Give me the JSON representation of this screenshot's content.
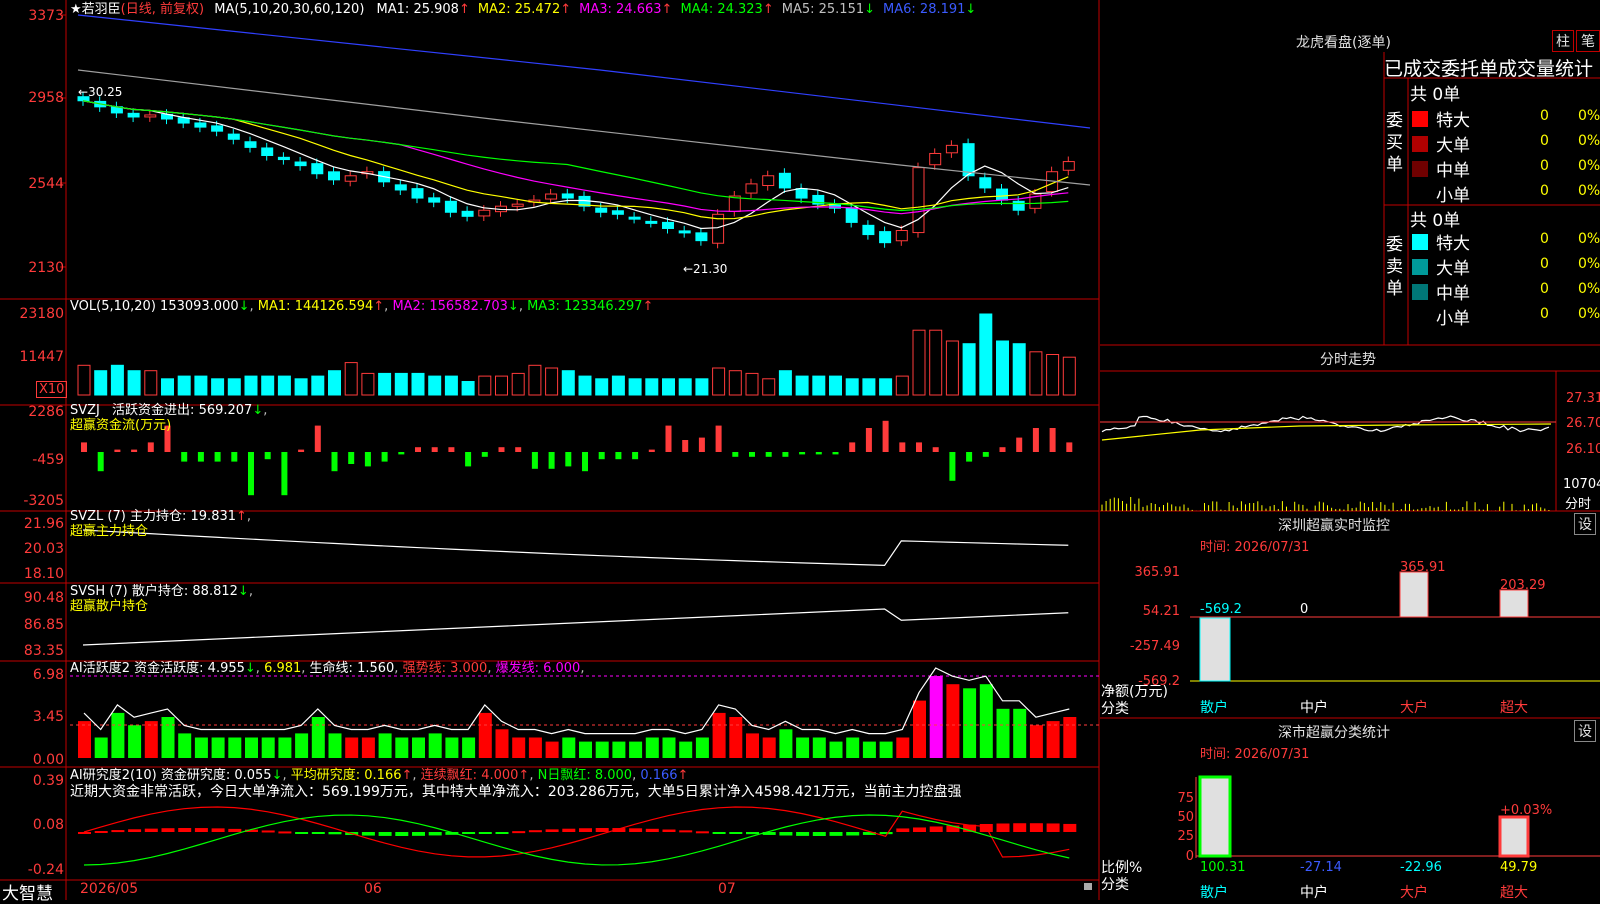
{
  "stock": {
    "star": "★",
    "name": "若羽臣",
    "period": "(日线, 前复权)"
  },
  "main_chart": {
    "ma_label": "MA(5,10,20,30,60,120)",
    "ma": [
      {
        "key": "MA1",
        "value": "25.908",
        "arrow": "↑",
        "color": "#ffffff"
      },
      {
        "key": "MA2",
        "value": "25.472",
        "arrow": "↑",
        "color": "#ffff00"
      },
      {
        "key": "MA3",
        "value": "24.663",
        "arrow": "↑",
        "color": "#ff00ff"
      },
      {
        "key": "MA4",
        "value": "24.323",
        "arrow": "↑",
        "color": "#00ff00"
      },
      {
        "key": "MA5",
        "value": "25.151",
        "arrow": "↓",
        "color": "#c0c0c0"
      },
      {
        "key": "MA6",
        "value": "28.191",
        "arrow": "↓",
        "color": "#3b5bff"
      }
    ],
    "y_ticks": [
      "3373",
      "2958",
      "2544",
      "2130"
    ],
    "annotations": {
      "high": "←30.25",
      "low": "←21.30"
    }
  },
  "vol": {
    "label": "VOL(5,10,20)",
    "value": "153093.000",
    "arrow": "↓",
    "ma1": "MA1: 144126.594",
    "ma1_arrow": "↑",
    "ma2": "MA2: 156582.703",
    "ma2_arrow": "↓",
    "ma3": "MA3: 123346.297",
    "ma3_arrow": "↑",
    "y_ticks": [
      "23180",
      "11447"
    ],
    "unit": "X10"
  },
  "svzj": {
    "label": "SVZJ",
    "title": "活跃资金进出:",
    "value": "569.207",
    "arrow": "↓",
    "sub": "超赢资金流(万元)",
    "y_ticks": [
      "2286",
      "-459",
      "-3205"
    ]
  },
  "svzl": {
    "label": "SVZL (7)",
    "title": "主力持仓:",
    "value": "19.831",
    "arrow": "↑",
    "sub": "超赢主力持仓",
    "y_ticks": [
      "21.96",
      "20.03",
      "18.10"
    ]
  },
  "svsh": {
    "label": "SVSH (7)",
    "title": "散户持仓:",
    "value": "88.812",
    "arrow": "↓",
    "sub": "超赢散户持仓",
    "y_ticks": [
      "90.48",
      "86.85",
      "83.35"
    ]
  },
  "ai1": {
    "label": "AI活跃度2",
    "t1": "资金活跃度:",
    "v1": "4.955",
    "a1": "↓",
    "v2": "6.981",
    "t3": "生命线:",
    "v3": "1.560",
    "t4": "强势线:",
    "v4": "3.000",
    "t5": "爆发线:",
    "v5": "6.000",
    "y_ticks": [
      "6.98",
      "3.45",
      "0.00"
    ]
  },
  "ai2": {
    "label": "AI研究度2(10)",
    "t1": "资金研究度:",
    "v1": "0.055",
    "a1": "↓",
    "t2": "平均研究度:",
    "v2": "0.166",
    "a2": "↑",
    "t3": "连续飘红:",
    "v3": "4.000",
    "a3": "↑",
    "t4": "N日飘红:",
    "v4": "8.000",
    "v5": "0.166",
    "a5": "↑",
    "message": "近期大资金非常活跃，今日大单净流入：569.199万元，其中特大单净流入：203.286万元，大单5日累计净入4598.421万元，当前主力控盘强",
    "y_ticks": [
      "0.39",
      "0.08",
      "-0.24"
    ]
  },
  "x_axis": {
    "months": [
      "2026/05",
      "06",
      "07"
    ],
    "brand": "大智慧"
  },
  "longhu": {
    "title": "龙虎看盘(逐单)",
    "btn_zhu": "柱",
    "btn_bi": "笔",
    "subtitle": "已成交委托单成交量统计",
    "buy_label": "委买单",
    "sell_label": "委卖单",
    "buy_total": "共 0单",
    "sell_total": "共 0单",
    "buy_rows": [
      {
        "name": "特大",
        "count": "0",
        "pct": "0%",
        "color": "#ff0000"
      },
      {
        "name": "大单",
        "count": "0",
        "pct": "0%",
        "color": "#b00000"
      },
      {
        "name": "中单",
        "count": "0",
        "pct": "0%",
        "color": "#700000"
      },
      {
        "name": "小单",
        "count": "0",
        "pct": "0%",
        "color": "#000000"
      }
    ],
    "sell_rows": [
      {
        "name": "特大",
        "count": "0",
        "pct": "0%",
        "color": "#00ffff"
      },
      {
        "name": "大单",
        "count": "0",
        "pct": "0%",
        "color": "#009999"
      },
      {
        "name": "中单",
        "count": "0",
        "pct": "0%",
        "color": "#007777"
      },
      {
        "name": "小单",
        "count": "0",
        "pct": "0%",
        "color": "#000000"
      }
    ]
  },
  "intraday": {
    "title": "分时走势",
    "y_ticks": [
      "27.31",
      "26.70",
      "26.10"
    ],
    "vol_tick": "10704",
    "vol_unit": "分时"
  },
  "monitor": {
    "title": "深圳超赢实时监控",
    "btn": "设",
    "time": "时间: 2026/07/31",
    "y_ticks": [
      "365.91",
      "54.21",
      "-257.49",
      "-569.2"
    ],
    "ylabel1": "净额(万元)",
    "ylabel2": "分类",
    "bars": [
      {
        "cat": "散户",
        "value": "-569.2"
      },
      {
        "cat": "中户",
        "value": "0"
      },
      {
        "cat": "大户",
        "value": "365.91"
      },
      {
        "cat": "超大",
        "value": "203.29"
      }
    ]
  },
  "classify": {
    "title": "深市超赢分类统计",
    "btn": "设",
    "time": "时间: 2026/07/31",
    "y_ticks": [
      "75",
      "50",
      "25",
      "0"
    ],
    "ylabel1": "比例%",
    "ylabel2": "分类",
    "top_label": "+0.03%",
    "bars": [
      {
        "cat": "散户",
        "value": "100.31"
      },
      {
        "cat": "中户",
        "value": "-27.14"
      },
      {
        "cat": "大户",
        "value": "-22.96"
      },
      {
        "cat": "超大",
        "value": "49.79"
      }
    ]
  }
}
